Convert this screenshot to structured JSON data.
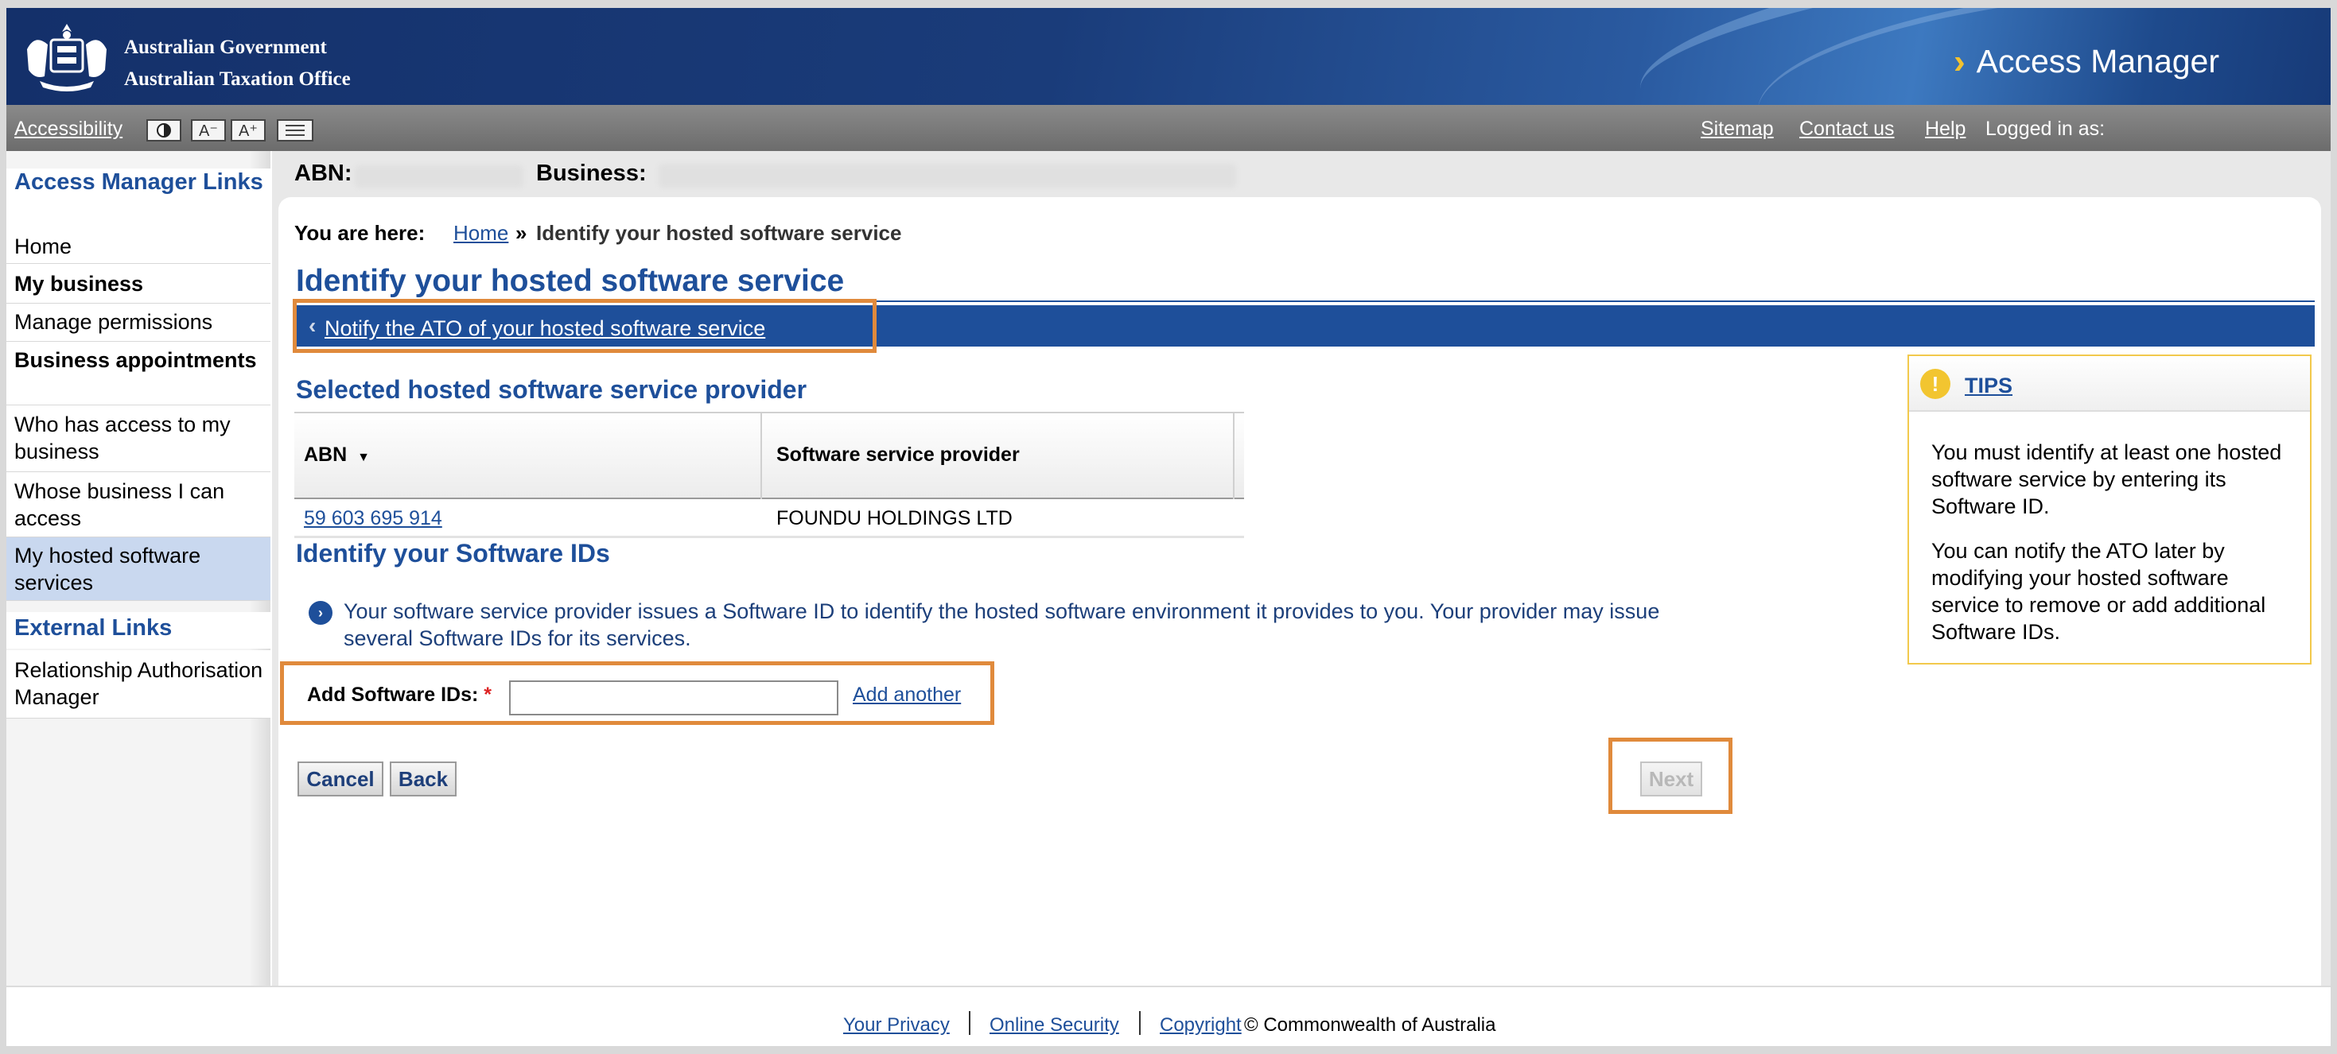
{
  "header": {
    "gov_line1": "Australian Government",
    "gov_line2": "Australian Taxation Office",
    "app_title": "Access Manager"
  },
  "utility": {
    "accessibility": "Accessibility",
    "sitemap": "Sitemap",
    "contact": "Contact us",
    "help": "Help",
    "logged_in": "Logged in as:"
  },
  "sidebar": {
    "heading": "Access Manager Links",
    "items": [
      {
        "label": "Home"
      },
      {
        "label": "My business"
      },
      {
        "label": "Manage permissions"
      },
      {
        "label": "Business appointments"
      },
      {
        "label": "Who has access to my business"
      },
      {
        "label": "Whose business I can access"
      },
      {
        "label": "My hosted software services"
      }
    ],
    "external_heading": "External Links",
    "external_items": [
      {
        "label": "Relationship Authorisation Manager"
      }
    ]
  },
  "business_bar": {
    "abn_label": "ABN:",
    "business_label": "Business:"
  },
  "breadcrumb": {
    "label": "You are here:",
    "home": "Home",
    "sep": "»",
    "current": "Identify your hosted software service"
  },
  "page": {
    "title": "Identify your hosted software service",
    "back_link": "Notify the ATO of your hosted software service",
    "selected_heading": "Selected hosted software service provider",
    "table": {
      "columns": [
        "ABN",
        "Software service provider"
      ],
      "rows": [
        {
          "abn": "59 603 695 914",
          "provider": "FOUNDU HOLDINGS LTD"
        }
      ]
    },
    "ids_heading": "Identify your Software IDs",
    "info_text": "Your software service provider issues a Software ID to identify the hosted software environment it provides to you. Your provider may issue several Software IDs for its services.",
    "field_label": "Add Software IDs:",
    "required_mark": "*",
    "software_id_value": "",
    "add_another": "Add another",
    "buttons": {
      "cancel": "Cancel",
      "back": "Back",
      "next": "Next"
    }
  },
  "tips": {
    "title": "TIPS",
    "p1": "You must identify at least one hosted software service by entering its Software ID.",
    "p2": "You can notify the ATO later by modifying your hosted software service to remove or add additional Software IDs."
  },
  "footer": {
    "privacy": "Your Privacy",
    "security": "Online Security",
    "copyright": "Copyright",
    "commonwealth": "© Commonwealth of Australia"
  },
  "colors": {
    "brand_blue": "#1e4f9a",
    "highlight": "#e08a3c",
    "tips_border": "#f2c94c"
  }
}
